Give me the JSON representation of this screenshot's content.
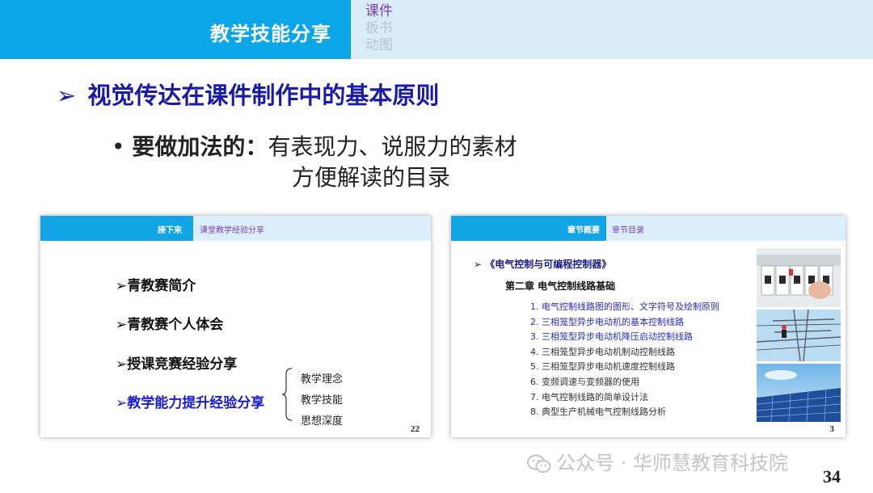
{
  "header": {
    "title": "教学技能分享",
    "tabs": [
      "课件",
      "板书",
      "动图"
    ]
  },
  "main": {
    "heading": "视觉传达在课件制作中的基本原则",
    "bullet_label": "要做加法的：",
    "bullet_line1": "有表现力、说服力的素材",
    "bullet_line2": "方便解读的目录"
  },
  "thumb1": {
    "header_title": "接下来",
    "header_sub": "课堂教学经验分享",
    "items": [
      "青教赛简介",
      "青教赛个人体会",
      "授课竞赛经验分享",
      "教学能力提升经验分享"
    ],
    "sub_items": [
      "教学理念",
      "教学技能",
      "思想深度"
    ],
    "page": "22"
  },
  "thumb2": {
    "header_title": "章节概要",
    "header_sub": "章节目录",
    "book": "《电气控制与可编程控制器》",
    "chapter": "第二章  电气控制线路基础",
    "list": [
      "1. 电气控制线路图的图形、文字符号及绘制原则",
      "2. 三相笼型异步电动机的基本控制线路",
      "3. 三相笼型异步电动机降压启动控制线路",
      "4. 三相笼型异步电动机制动控制线路",
      "5. 三相笼型异步电动机速度控制线路",
      "6. 变频调速与变频器的使用",
      "7. 电气控制线路的简单设计法",
      "8. 典型生产机械电气控制线路分析"
    ],
    "page": "3"
  },
  "footer": {
    "watermark": "公众号 · 华师慧教育科技院",
    "page": "34"
  },
  "icons": [
    "arrow-right-icon",
    "bullet-dot-icon",
    "brace-icon",
    "wechat-icon"
  ],
  "colors": {
    "header_blue": "#0aa6e8",
    "header_light": "#d9ecf8",
    "heading_navy": "#1a1aa8",
    "tab_purple": "#7a3fb8"
  }
}
